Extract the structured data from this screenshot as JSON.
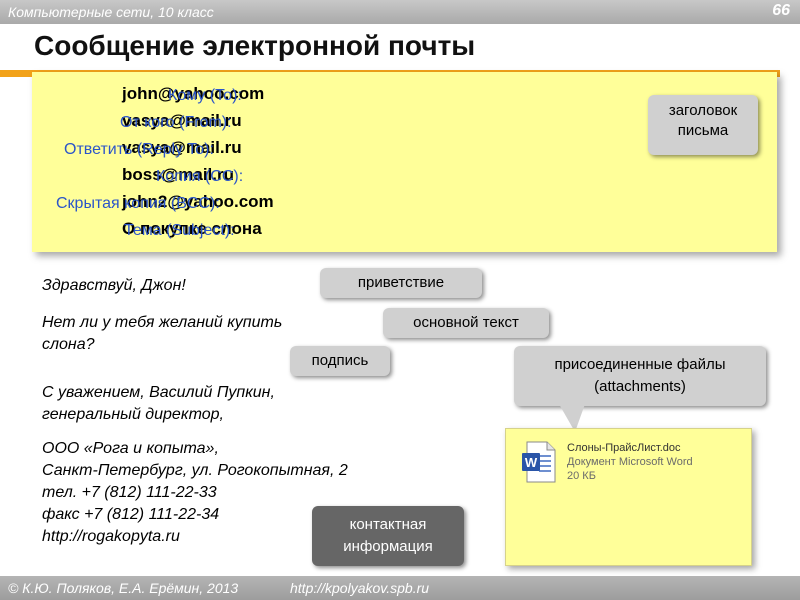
{
  "topbar": {
    "course": "Компьютерные сети, 10 класс",
    "page_number": "66"
  },
  "title": "Сообщение электронной почты",
  "header": {
    "labels": [
      "Кому (To):",
      "От кого (From):",
      "Ответить (Reply To):",
      "Копия (CC):",
      "Скрытая копия (BCC):",
      "Тема (Subject):"
    ],
    "values": [
      "john@yahoo.com",
      "vasya@mail.ru",
      "vasya@mail.ru",
      "boss@mail.ru",
      "john2@yahoo.com",
      "О покупке слона"
    ]
  },
  "callouts": {
    "header": [
      "заголовок",
      "письма"
    ],
    "greeting": "приветствие",
    "main_text": "основной текст",
    "signature": "подпись",
    "attachments": [
      "присоединенные файлы",
      "(attachments)"
    ],
    "contacts": [
      "контактная",
      "информация"
    ]
  },
  "letter": {
    "greeting": "Здравствуй, Джон!",
    "body": [
      "Нет ли у тебя желаний купить",
      "слона?"
    ],
    "signature": [
      "С уважением, Василий Пупкин,",
      "генеральный директор,"
    ],
    "contacts": [
      "ООО «Рога и копыта»,",
      "Санкт-Петербург, ул. Рогокопытная, 2",
      "тел. +7 (812) 111-22-33",
      "факс +7 (812) 111-22-34",
      "http://rogakopyta.ru"
    ]
  },
  "attachment": {
    "filename": "Слоны-ПрайсЛист.doc",
    "type": "Документ Microsoft Word",
    "size": "20 КБ",
    "icon": "word-document-icon"
  },
  "footer": {
    "copyright": "© К.Ю. Поляков, Е.А. Ерёмин, 2013",
    "url": "http://kpolyakov.spb.ru"
  },
  "colors": {
    "accent": "#f2a21a",
    "header_bg": "#ffff99",
    "label_blue": "#2b55c9"
  }
}
